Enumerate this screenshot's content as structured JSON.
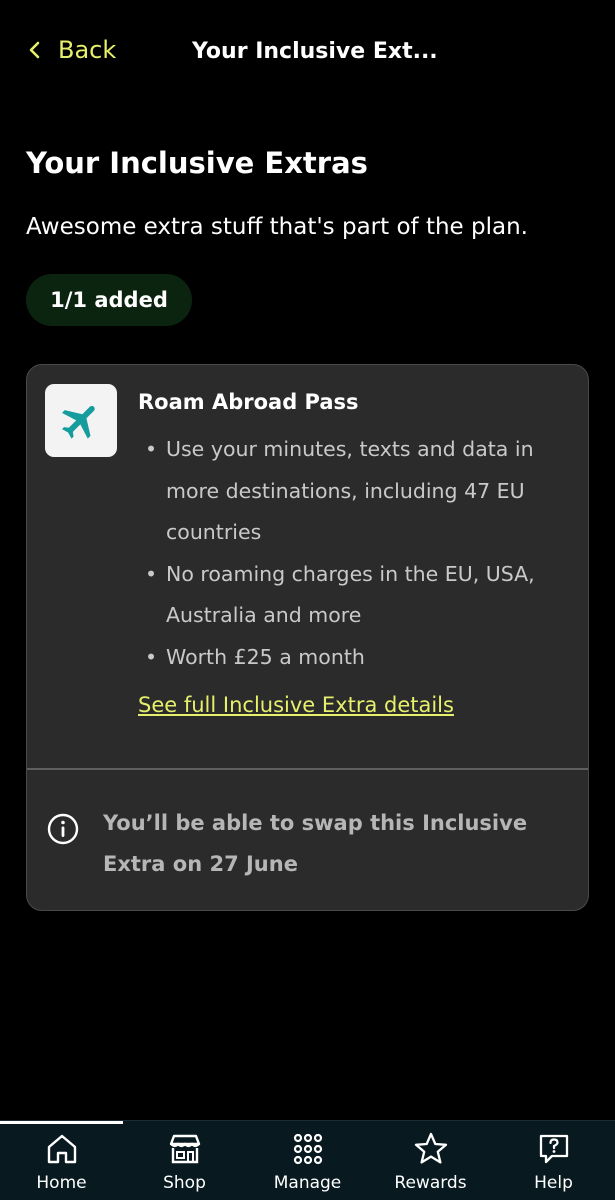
{
  "header": {
    "back_label": "Back",
    "title": "Your Inclusive Ext..."
  },
  "page": {
    "title": "Your Inclusive Extras",
    "subtitle": "Awesome extra stuff that's part of the plan.",
    "status_pill": "1/1 added"
  },
  "extra_card": {
    "icon": "airplane-icon",
    "title": "Roam Abroad Pass",
    "bullets": [
      "Use your minutes, texts and data in more destinations, including 47 EU countries",
      "No roaming charges in the  EU, USA, Australia and more",
      "Worth £25 a month"
    ],
    "details_link": "See full Inclusive Extra details",
    "info_icon": "info-icon",
    "info_text": "You’ll be able to swap this Inclusive Extra on 27 June"
  },
  "bottom_nav": {
    "items": [
      {
        "label": "Home",
        "icon": "home-icon",
        "active": true
      },
      {
        "label": "Shop",
        "icon": "shop-icon"
      },
      {
        "label": "Manage",
        "icon": "grid-icon"
      },
      {
        "label": "Rewards",
        "icon": "star-icon"
      },
      {
        "label": "Help",
        "icon": "help-chat-icon"
      }
    ]
  },
  "colors": {
    "background": "#000000",
    "accent": "#e6f06a",
    "card_bg": "#2b2b2b",
    "pill_bg": "#0b2410",
    "icon_teal": "#159c9c",
    "nav_bg": "#08191f"
  }
}
